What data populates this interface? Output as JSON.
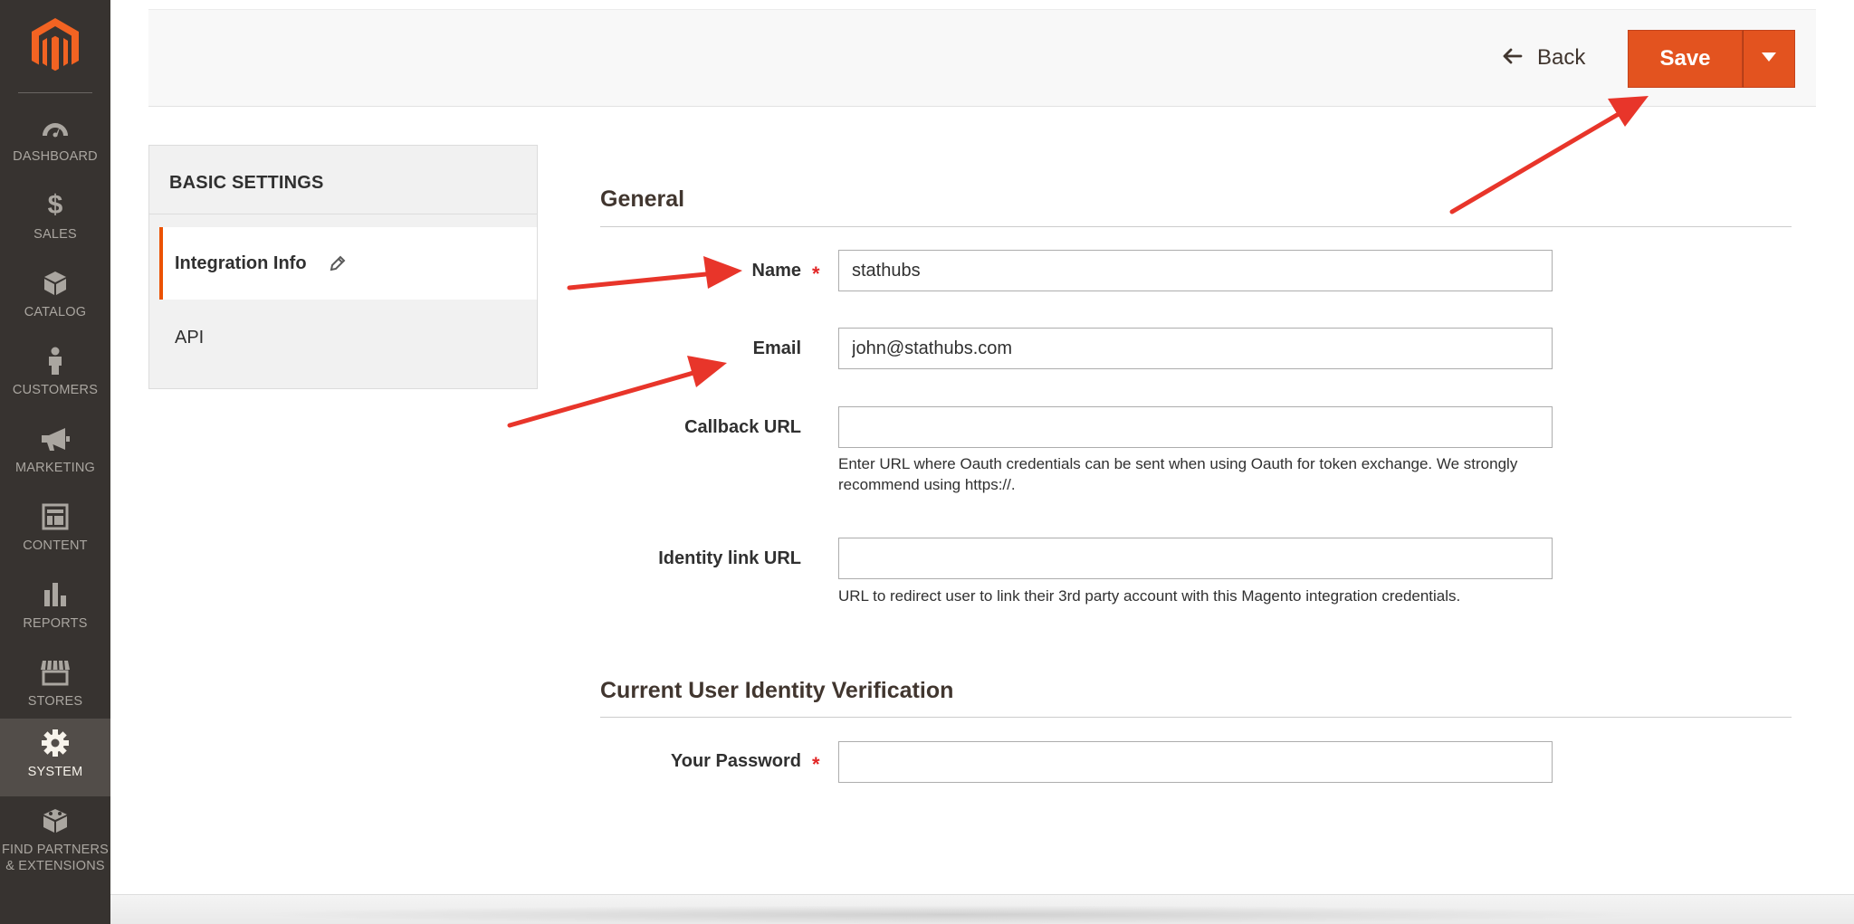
{
  "sidebar": {
    "items": [
      {
        "label": "DASHBOARD",
        "icon": "dashboard-icon"
      },
      {
        "label": "SALES",
        "icon": "dollar-icon"
      },
      {
        "label": "CATALOG",
        "icon": "box-icon"
      },
      {
        "label": "CUSTOMERS",
        "icon": "person-icon"
      },
      {
        "label": "MARKETING",
        "icon": "megaphone-icon"
      },
      {
        "label": "CONTENT",
        "icon": "layout-icon"
      },
      {
        "label": "REPORTS",
        "icon": "bar-chart-icon"
      },
      {
        "label": "STORES",
        "icon": "storefront-icon"
      },
      {
        "label": "SYSTEM",
        "icon": "gear-icon",
        "active": true
      },
      {
        "label_line1": "FIND PARTNERS",
        "label_line2": "& EXTENSIONS",
        "icon": "blocks-icon"
      }
    ]
  },
  "header": {
    "back_label": "Back",
    "save_label": "Save"
  },
  "tabs": {
    "title": "BASIC SETTINGS",
    "items": [
      {
        "label": "Integration Info",
        "active": true
      },
      {
        "label": "API",
        "active": false
      }
    ]
  },
  "form": {
    "general_title": "General",
    "name": {
      "label": "Name",
      "value": "stathubs",
      "required": true
    },
    "email": {
      "label": "Email",
      "value": "john@stathubs.com"
    },
    "callback_url": {
      "label": "Callback URL",
      "value": "",
      "note": "Enter URL where Oauth credentials can be sent when using Oauth for token exchange. We strongly recommend using https://."
    },
    "identity_link_url": {
      "label": "Identity link URL",
      "value": "",
      "note": "URL to redirect user to link their 3rd party account with this Magento integration credentials."
    },
    "verification_title": "Current User Identity Verification",
    "password": {
      "label": "Your Password",
      "value": "",
      "required": true
    },
    "required_mark": "*"
  },
  "colors": {
    "sidebar_bg": "#373330",
    "sidebar_active": "#524d49",
    "accent": "#e3531f",
    "annotation_arrow": "#e8352a"
  }
}
